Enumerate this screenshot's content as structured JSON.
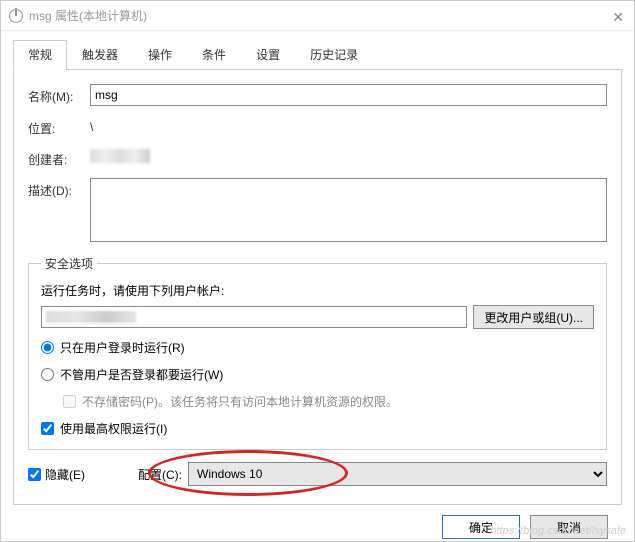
{
  "title": "msg 属性(本地计算机)",
  "tabs": [
    "常规",
    "触发器",
    "操作",
    "条件",
    "设置",
    "历史记录"
  ],
  "general": {
    "name_label": "名称(M):",
    "name_value": "msg",
    "location_label": "位置:",
    "location_value": "\\",
    "creator_label": "创建者:",
    "description_label": "描述(D):",
    "description_value": ""
  },
  "security": {
    "legend": "安全选项",
    "runas_label": "运行任务时，请使用下列用户帐户:",
    "change_user_btn": "更改用户或组(U)...",
    "radio_logged_on": "只在用户登录时运行(R)",
    "radio_any_user": "不管用户是否登录都要运行(W)",
    "no_store_pwd": "不存储密码(P)。该任务将只有访问本地计算机资源的权限。",
    "highest_priv": "使用最高权限运行(I)"
  },
  "bottom": {
    "hidden_label": "隐藏(E)",
    "config_label": "配置(C):",
    "config_value": "Windows 10"
  },
  "footer": {
    "ok": "确定",
    "cancel": "取消"
  },
  "watermark": "https://blog.csdn.net/lsysafe"
}
